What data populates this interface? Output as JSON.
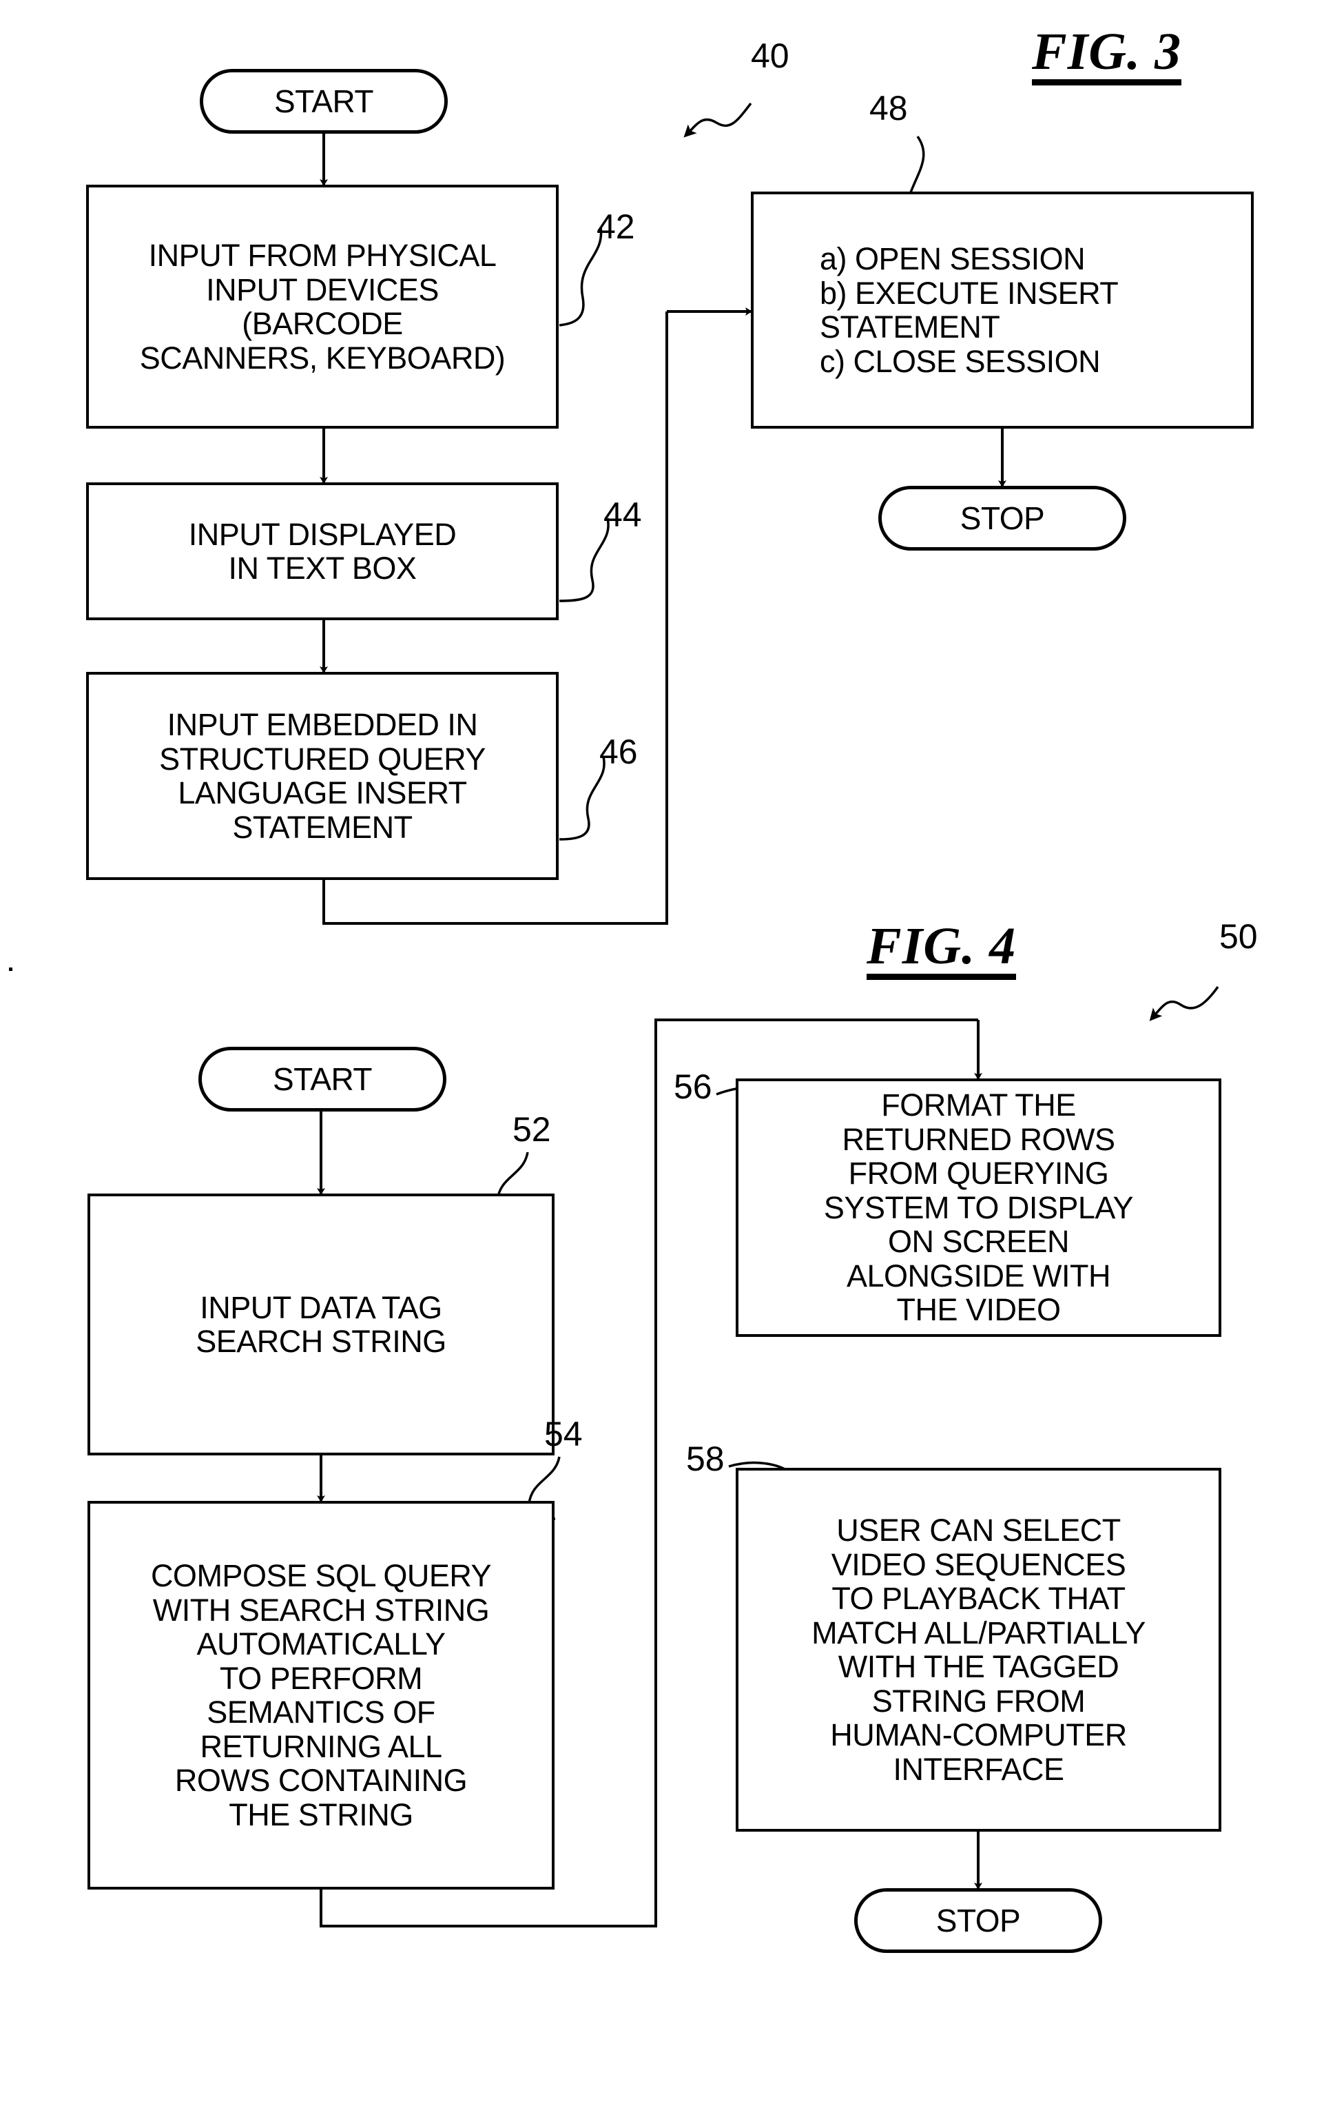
{
  "figures": [
    {
      "id": "fig3",
      "title": "FIG. 3",
      "ref_label": "40",
      "nodes": {
        "start": {
          "label": "START"
        },
        "n42": {
          "ref": "42",
          "lines": [
            "INPUT FROM PHYSICAL",
            "INPUT DEVICES",
            "(BARCODE",
            "SCANNERS, KEYBOARD)"
          ]
        },
        "n44": {
          "ref": "44",
          "lines": [
            "INPUT DISPLAYED",
            "IN TEXT BOX"
          ]
        },
        "n46": {
          "ref": "46",
          "lines": [
            "INPUT EMBEDDED IN",
            "STRUCTURED QUERY",
            "LANGUAGE INSERT",
            "STATEMENT"
          ]
        },
        "n48": {
          "ref": "48",
          "lines": [
            "a) OPEN SESSION",
            "b) EXECUTE INSERT",
            "    STATEMENT",
            "c) CLOSE SESSION"
          ]
        },
        "stop": {
          "label": "STOP"
        }
      }
    },
    {
      "id": "fig4",
      "title": "FIG. 4",
      "ref_label": "50",
      "nodes": {
        "start": {
          "label": "START"
        },
        "n52": {
          "ref": "52",
          "lines": [
            "INPUT DATA TAG",
            "SEARCH STRING"
          ]
        },
        "n54": {
          "ref": "54",
          "lines": [
            "COMPOSE SQL QUERY",
            "WITH SEARCH STRING",
            "AUTOMATICALLY",
            "TO PERFORM",
            "SEMANTICS OF",
            "RETURNING ALL",
            "ROWS CONTAINING",
            "THE STRING"
          ]
        },
        "n56": {
          "ref": "56",
          "lines": [
            "FORMAT THE",
            "RETURNED ROWS",
            "FROM QUERYING",
            "SYSTEM TO DISPLAY",
            "ON SCREEN",
            "ALONGSIDE WITH",
            "THE VIDEO"
          ]
        },
        "n58": {
          "ref": "58",
          "lines": [
            "USER CAN SELECT",
            "VIDEO SEQUENCES",
            "TO PLAYBACK THAT",
            "MATCH ALL/PARTIALLY",
            "WITH THE TAGGED",
            "STRING FROM",
            "HUMAN-COMPUTER",
            "INTERFACE"
          ]
        },
        "stop": {
          "label": "STOP"
        }
      }
    }
  ],
  "style": {
    "ink": "#000000",
    "paper": "#ffffff"
  }
}
